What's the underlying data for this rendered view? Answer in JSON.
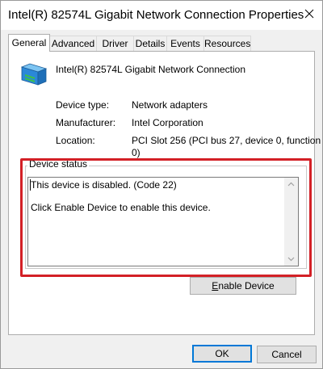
{
  "window": {
    "title": "Intel(R) 82574L Gigabit Network Connection Properties",
    "close_icon": "close-icon"
  },
  "tabs": [
    {
      "label": "General",
      "active": true
    },
    {
      "label": "Advanced"
    },
    {
      "label": "Driver"
    },
    {
      "label": "Details"
    },
    {
      "label": "Events"
    },
    {
      "label": "Resources"
    }
  ],
  "general": {
    "device_icon": "network-adapter-icon",
    "device_name": "Intel(R) 82574L Gigabit Network Connection",
    "properties": [
      {
        "label": "Device type:",
        "value": "Network adapters"
      },
      {
        "label": "Manufacturer:",
        "value": "Intel Corporation"
      },
      {
        "label": "Location:",
        "value_line1": "PCI Slot 256 (PCI bus 27, device 0, function",
        "value_line2": "0)"
      }
    ],
    "device_status": {
      "title": "Device status",
      "line1": "This device is disabled. (Code 22)",
      "line2": "Click Enable Device to enable this device."
    },
    "enable_button": {
      "mnemonic": "E",
      "rest": "nable Device"
    }
  },
  "footer": {
    "ok_label": "OK",
    "cancel_label": "Cancel"
  },
  "colors": {
    "highlight": "#d32026",
    "default_button_border": "#0078d7"
  }
}
